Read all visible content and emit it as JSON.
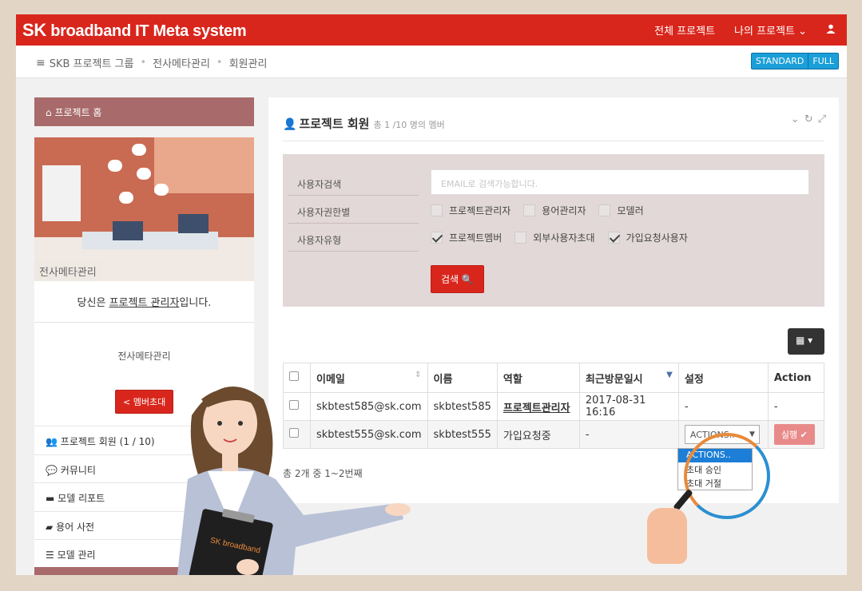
{
  "topbar": {
    "logo_sk": "SK",
    "logo_rest": " broadband IT Meta system",
    "nav_all_projects": "전체 프로젝트",
    "nav_my_projects": "나의 프로젝트",
    "colors": {
      "brand": "#d9261c"
    }
  },
  "breadcrumb": {
    "items": [
      "SKB 프로젝트 그룹",
      "전사메타관리",
      "회원관리"
    ],
    "view_standard": "STANDARD",
    "view_full": "FULL"
  },
  "sidebar": {
    "home": "프로젝트 홈",
    "illustration_label": "전사메타관리",
    "role_prefix": "당신은 ",
    "role_link": "프로젝트 관리자",
    "role_suffix": "입니다.",
    "project_name": "전사메타관리",
    "invite_button": "멤버초대",
    "menu": [
      {
        "label": "프로젝트 회원 (1 / 10)",
        "icon": "users-icon"
      },
      {
        "label": "커뮤니티",
        "icon": "comments-icon"
      },
      {
        "label": "모델 리포트",
        "icon": "archive-icon"
      },
      {
        "label": "용어 사전",
        "icon": "book-icon"
      },
      {
        "label": "모델 관리",
        "icon": "database-icon"
      }
    ]
  },
  "panel": {
    "title": "프로젝트 회원",
    "subtitle": "총 1 /10 명의 멤버",
    "search": {
      "label_user_search": "사용자검색",
      "label_permission": "사용자권한별",
      "label_type": "사용자유형",
      "placeholder": "EMAIL로 검색가능합니다.",
      "permission_options": [
        {
          "label": "프로젝트관리자",
          "checked": false
        },
        {
          "label": "용어관리자",
          "checked": false
        },
        {
          "label": "모델러",
          "checked": false
        }
      ],
      "type_options": [
        {
          "label": "프로젝트멤버",
          "checked": true
        },
        {
          "label": "외부사용자초대",
          "checked": false
        },
        {
          "label": "가입요청사용자",
          "checked": true
        }
      ],
      "button": "검색"
    },
    "table": {
      "headers": [
        "이메일",
        "이름",
        "역할",
        "최근방문일시",
        "설정",
        "Action"
      ],
      "rows": [
        {
          "email": "skbtest585@sk.com",
          "name": "skbtest585",
          "role": "프로젝트관리자",
          "last_visit": "2017-08-31 16:16",
          "setting": "-",
          "action": "-"
        },
        {
          "email": "skbtest555@sk.com",
          "name": "skbtest555",
          "role": "가입요청중",
          "last_visit": "-",
          "setting": "ACTIONS..",
          "action": "실행"
        }
      ]
    },
    "summary": "총 2개 중 1~2번째",
    "dropdown_options": [
      "ACTIONS..",
      "초대 승인",
      "초대 거절"
    ]
  },
  "clipboard_text": "SK broadband"
}
